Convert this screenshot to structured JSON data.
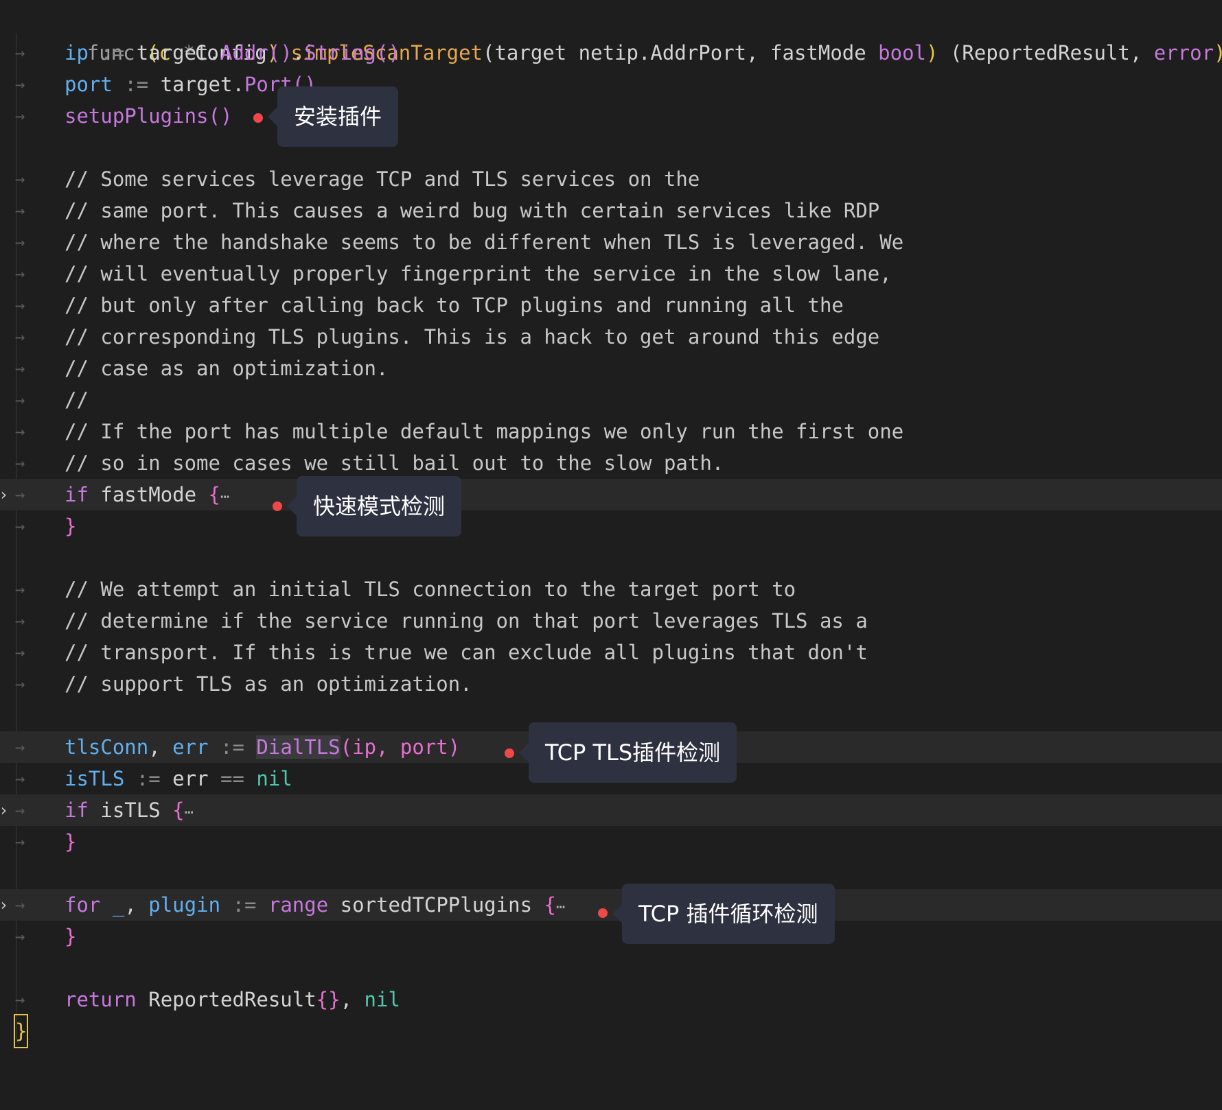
{
  "code": {
    "func_kw": "func",
    "receiver_open": "(c ",
    "receiver_star": "*",
    "receiver_type": "Config",
    "receiver_close": ")",
    "func_name": "simpleScanTarget",
    "params": "(target netip.AddrPort, fastMode ",
    "bool_type": "bool",
    "params_close": ")",
    "returns_open": " (ReportedResult, ",
    "error_type": "error",
    "returns_close": ")",
    "open_brace": "{",
    "ip_var": "ip",
    "assign": ":=",
    "target_obj": "target.",
    "addr_method": "Addr()",
    "dot": ".",
    "string_method": "String()",
    "port_var": "port",
    "port_method": "Port()",
    "setup_call": "setupPlugins()",
    "comments_a": [
      "// Some services leverage TCP and TLS services on the",
      "// same port. This causes a weird bug with certain services like RDP",
      "// where the handshake seems to be different when TLS is leveraged. We",
      "// will eventually properly fingerprint the service in the slow lane,",
      "// but only after calling back to TCP plugins and running all the",
      "// corresponding TLS plugins. This is a hack to get around this edge",
      "// case as an optimization.",
      "//",
      "// If the port has multiple default mappings we only run the first one",
      "// so in some cases we still bail out to the slow path."
    ],
    "if_kw": "if",
    "fastmode_cond": "fastMode",
    "brace_open": "{",
    "brace_close": "}",
    "ellipsis": "⋯",
    "comments_b": [
      "// We attempt an initial TLS connection to the target port to",
      "// determine if the service running on that port leverages TLS as a",
      "// transport. If this is true we can exclude all plugins that don't",
      "// support TLS as an optimization."
    ],
    "tlsconn_var": "tlsConn",
    "comma": ",",
    "err_var": "err",
    "dialtls_fn": "DialTLS",
    "dial_args": "(ip, port)",
    "istls_var": "isTLS",
    "err_plain": "err",
    "eqeq": "==",
    "nil_kw": "nil",
    "istls_cond": "isTLS",
    "for_kw": "for",
    "underscore": "_",
    "plugin_var": "plugin",
    "range_kw": "range",
    "sorted_plugins": "sortedTCPPlugins",
    "return_kw": "return",
    "reported_result": "ReportedResult",
    "empty_braces": "{}",
    "close_brace": "}"
  },
  "gutter": {
    "indent_glyph": "→",
    "fold_glyph": "›"
  },
  "callouts": {
    "install_plugins": "安装插件",
    "fast_mode": "快速模式检测",
    "tcp_tls": "TCP TLS插件检测",
    "tcp_loop": "TCP 插件循环检测"
  },
  "colors": {
    "background": "#1e1e1e",
    "callout_bg": "#2d3140",
    "marker_red": "#f04848"
  }
}
